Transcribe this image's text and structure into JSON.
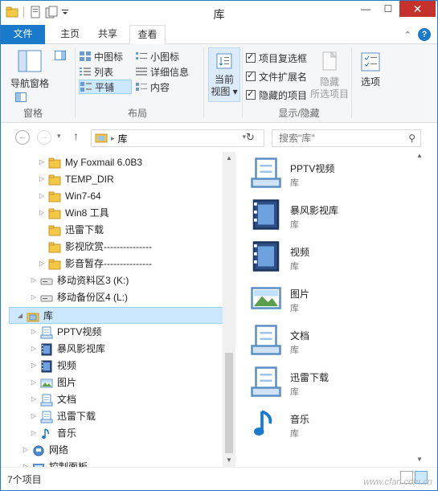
{
  "window": {
    "title": "库"
  },
  "tabs": {
    "file": "文件",
    "home": "主页",
    "share": "共享",
    "view": "查看"
  },
  "ribbon": {
    "pane": {
      "nav_pane": "导航窗格",
      "group": "窗格"
    },
    "layout": {
      "medium_icons": "中图标",
      "small_icons": "小图标",
      "list": "列表",
      "details": "详细信息",
      "tiles": "平铺",
      "content": "内容",
      "group": "布局"
    },
    "current_view": {
      "label_line1": "当前",
      "label_line2": "视图"
    },
    "show_hide": {
      "item_checkboxes": "项目复选框",
      "file_extensions": "文件扩展名",
      "hidden_items": "隐藏的项目",
      "hide_line1": "隐藏",
      "hide_line2": "所选项目",
      "group": "显示/隐藏"
    },
    "options": "选项"
  },
  "address": {
    "path": "库",
    "search_placeholder": "搜索\"库\""
  },
  "nav_tree": [
    {
      "label": "My Foxmail 6.0B3",
      "icon": "folder-icon",
      "arrow": "▷"
    },
    {
      "label": "TEMP_DIR",
      "icon": "folder-icon",
      "arrow": "▷"
    },
    {
      "label": "Win7-64",
      "icon": "folder-icon",
      "arrow": "▷"
    },
    {
      "label": "Win8 工具",
      "icon": "folder-icon",
      "arrow": "▷"
    },
    {
      "label": "迅雷下载",
      "icon": "folder-icon",
      "arrow": ""
    },
    {
      "label": "影视欣赏---------------",
      "icon": "folder-icon",
      "arrow": ""
    },
    {
      "label": "影音暂存---------------",
      "icon": "folder-icon",
      "arrow": "▷"
    },
    {
      "label": "移动资料区3 (K:)",
      "icon": "drive-icon",
      "arrow": "▷"
    },
    {
      "label": "移动备份区4 (L:)",
      "icon": "drive-icon",
      "arrow": "▷"
    },
    {
      "label": "库",
      "icon": "library-icon",
      "arrow": "◢"
    },
    {
      "label": "PPTV视频",
      "icon": "library-doc-icon",
      "arrow": "▷"
    },
    {
      "label": "暴风影视库",
      "icon": "library-video-icon",
      "arrow": "▷"
    },
    {
      "label": "视频",
      "icon": "library-video-icon",
      "arrow": "▷"
    },
    {
      "label": "图片",
      "icon": "library-picture-icon",
      "arrow": "▷"
    },
    {
      "label": "文档",
      "icon": "library-doc-icon",
      "arrow": "▷"
    },
    {
      "label": "迅雷下载",
      "icon": "library-doc-icon",
      "arrow": "▷"
    },
    {
      "label": "音乐",
      "icon": "library-music-icon",
      "arrow": "▷"
    },
    {
      "label": "网络",
      "icon": "network-icon",
      "arrow": "▷"
    },
    {
      "label": "控制面板",
      "icon": "control-panel-icon",
      "arrow": "▷"
    }
  ],
  "libraries": [
    {
      "name": "PPTV视频",
      "type": "库",
      "icon": "library-doc-icon"
    },
    {
      "name": "暴风影视库",
      "type": "库",
      "icon": "library-video-icon"
    },
    {
      "name": "视频",
      "type": "库",
      "icon": "library-video-icon"
    },
    {
      "name": "图片",
      "type": "库",
      "icon": "library-picture-icon"
    },
    {
      "name": "文档",
      "type": "库",
      "icon": "library-doc-icon"
    },
    {
      "name": "迅雷下载",
      "type": "库",
      "icon": "library-doc-icon"
    },
    {
      "name": "音乐",
      "type": "库",
      "icon": "library-music-icon"
    }
  ],
  "status": {
    "count": "7个项目"
  },
  "watermark": "www.cfan.com.cn",
  "colors": {
    "accent": "#1979ca",
    "selection": "#cce8ff",
    "folder": "#f3c845"
  }
}
